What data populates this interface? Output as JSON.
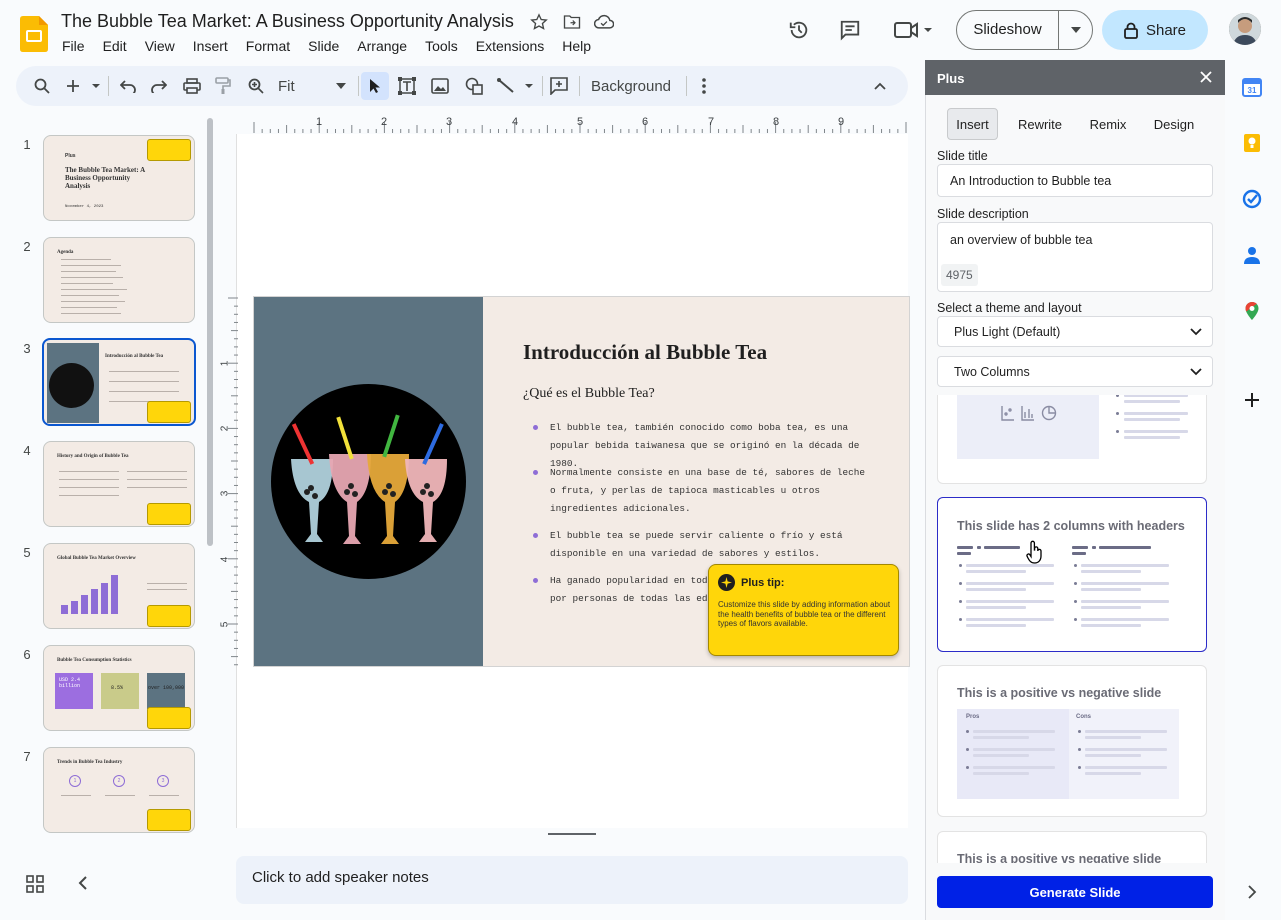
{
  "app": {
    "doc_title": "The Bubble Tea Market: A Business Opportunity Analysis",
    "menu": [
      "File",
      "Edit",
      "View",
      "Insert",
      "Format",
      "Slide",
      "Arrange",
      "Tools",
      "Extensions",
      "Help"
    ],
    "slideshow_label": "Slideshow",
    "share_label": "Share"
  },
  "toolbar": {
    "zoom": "Fit",
    "background_label": "Background"
  },
  "ruler": {
    "h_ticks": [
      "1",
      "2",
      "3",
      "4",
      "5",
      "6",
      "7",
      "8",
      "9"
    ],
    "v_ticks": [
      "1",
      "2",
      "3",
      "4",
      "5"
    ]
  },
  "filmstrip": {
    "numbers": [
      "1",
      "2",
      "3",
      "4",
      "5",
      "6",
      "7"
    ],
    "slide1_title": "The Bubble Tea Market: A Business Opportunity Analysis",
    "slide1_brand": "Plus",
    "slide1_date": "November 4, 2023",
    "slide2_title": "Agenda",
    "slide3_title": "Introducción al Bubble Tea",
    "slide4_title": "History and Origin of Bubble Tea",
    "slide5_title": "Global Bubble Tea Market Overview",
    "slide6_title": "Bubble Tea Consumption Statistics",
    "slide6_stat1": "USD 2.4 billion",
    "slide6_stat2": "8.5%",
    "slide6_stat3": "over 100,000",
    "slide7_title": "Trends in Bubble Tea Industry",
    "slide7_nums": [
      "1",
      "2",
      "3"
    ]
  },
  "slide": {
    "title": "Introducción al Bubble Tea",
    "subtitle": "¿Qué es el Bubble Tea?",
    "bullets": [
      "El bubble tea, también conocido como boba tea, es una popular bebida taiwanesa que se originó en la década de 1980.",
      "Normalmente consiste en una base de té, sabores de leche o fruta, y perlas de tapioca masticables u otros ingredientes adicionales.",
      "El bubble tea se puede servir caliente o frío y está disponible en una variedad de sabores y estilos.",
      "Ha ganado popularidad en todo el mundo y es disfrutado por personas de todas las edades."
    ],
    "tip_title": "Plus tip:",
    "tip_body": "Customize this slide by adding information about the health benefits of bubble tea or the different types of flavors available."
  },
  "notes_placeholder": "Click to add speaker notes",
  "panel": {
    "title": "Plus",
    "tabs": [
      "Insert",
      "Rewrite",
      "Remix",
      "Design"
    ],
    "active_tab": "Insert",
    "slide_title_label": "Slide title",
    "slide_title_value": "An Introduction to Bubble tea",
    "slide_desc_label": "Slide description",
    "slide_desc_value": "an overview of bubble tea",
    "char_count": "4975",
    "theme_label": "Select a theme and layout",
    "theme_value": "Plus Light (Default)",
    "layout_value": "Two Columns",
    "cards": [
      "This slide has 2 columns with headers",
      "This is a positive vs negative slide",
      "This is a positive vs negative slide"
    ],
    "pros_label": "Pros",
    "cons_label": "Cons",
    "generate_label": "Generate Slide"
  },
  "colors": {
    "accent": "#0b57d0",
    "share_bg": "#c2e7ff",
    "tip_yellow": "#ffd60a",
    "slide_left": "#5c7381",
    "generate": "#0021e6"
  }
}
